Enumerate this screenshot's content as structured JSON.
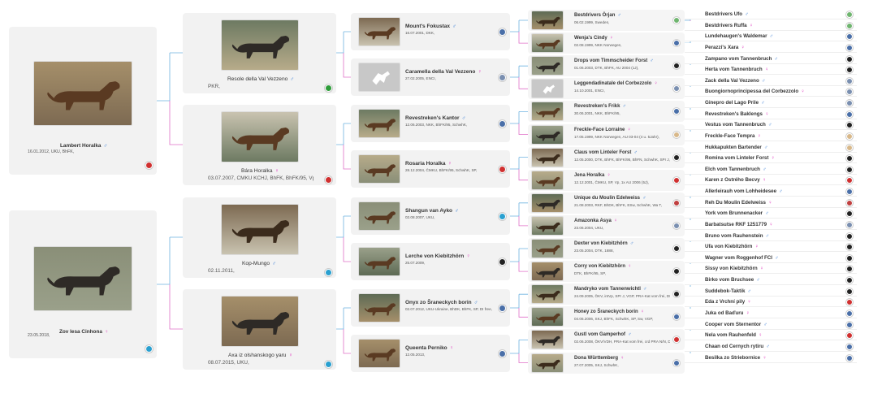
{
  "generations": {
    "g1": [
      {
        "name": "Lambert Horalka",
        "sex": "♂",
        "info": "16.01.2012, UKU, BhFK,",
        "flag_color": "#d03030"
      },
      {
        "name": "Zov lesa Cinhona",
        "sex": "♀",
        "info": "23.05.2018,",
        "flag_color": "#2aa0d0"
      }
    ],
    "g2": [
      {
        "name": "Resole della Val Vezzeno",
        "sex": "♂",
        "info": "PKR,",
        "flag_color": "#2e9d3a"
      },
      {
        "name": "Bára Horalka",
        "sex": "♀",
        "info": "03.07.2007, ČMKU KCHJ, BhFK, BhFK/95, Vp,",
        "flag_color": "#d03030"
      },
      {
        "name": "Kop-Mungo",
        "sex": "♂",
        "info": "02.11.2011,",
        "flag_color": "#2aa0d0"
      },
      {
        "name": "Axa iz olshanskogo yaru",
        "sex": "♀",
        "info": "08.07.2015, UKU,",
        "flag_color": "#2aa0d0"
      }
    ],
    "g3": [
      {
        "name": "Mount's Fokustax",
        "sex": "♂",
        "info": "16.07.2001, DKK,",
        "flag_color": "#4a6fa8"
      },
      {
        "name": "Caramella della Val Vezzeno",
        "sex": "♀",
        "info": "27.02.2005, ENCI,",
        "flag_color": "#7a8fb0"
      },
      {
        "name": "Revestreken's Kantor",
        "sex": "♂",
        "info": "12.06.2003, NKK, BhFK/95, SchwhK,",
        "flag_color": "#4a6fa8"
      },
      {
        "name": "Rosaria Horalka",
        "sex": "♀",
        "info": "28.12.2004, ČMKU, BhFK/95, SchwhK, SP,",
        "flag_color": "#d03030"
      },
      {
        "name": "Shangun van Ayko",
        "sex": "♂",
        "info": "02.08.2007, UKU,",
        "flag_color": "#2aa0d0"
      },
      {
        "name": "Lerche von Kiebitzhörn",
        "sex": "♀",
        "info": "25.07.2009,",
        "flag_color": "#222222"
      },
      {
        "name": "Onyx zo Šraneckych borin",
        "sex": "♂",
        "info": "02.07.2012, UKU-Ukraine, BhDK, BhFK, SP, DI free,",
        "flag_color": "#4a6fa8"
      },
      {
        "name": "Queenta Perniko",
        "sex": "♀",
        "info": "12.05.2013,",
        "flag_color": "#4a6fa8"
      }
    ],
    "g4": [
      {
        "name": "Bestdrivers Örjan",
        "sex": "♂",
        "info": "06.02.1999, Sweden,",
        "flag_color": "#6fb56f"
      },
      {
        "name": "Wenja's Cindy",
        "sex": "♀",
        "info": "02.08.1999, NKK Norwegen,",
        "flag_color": "#4a6fa8"
      },
      {
        "name": "Drops vom Timmscheider Forst",
        "sex": "♂",
        "info": "01.06.2003, DTK, BhFK, AU 2004 (1J),",
        "flag_color": "#222222"
      },
      {
        "name": "Leggendadinatale del Corbezzolo",
        "sex": "♀",
        "info": "14.10.2001, ENCI,",
        "flag_color": "#7a8fb0"
      },
      {
        "name": "Revestreken's Frikk",
        "sex": "♂",
        "info": "30.06.2001, NKK, BhFK/95,",
        "flag_color": "#4a6fa8"
      },
      {
        "name": "Freckle-Face Lorraine",
        "sex": "♀",
        "info": "17.05.1999, NKK Norwegen, AU 03-04 (4 u. 5Jahr),",
        "flag_color": "#d8b88a"
      },
      {
        "name": "Claus vom Linteler Forst",
        "sex": "♂",
        "info": "12.05.2000, DTK, BhFK, BhFK/95, BhFN, SchwhK, SPr J, VpzSp,",
        "flag_color": "#222222"
      },
      {
        "name": "Jena Horalka",
        "sex": "♀",
        "info": "12.12.2001, ČMKU, SP, Vp, 1x AU 2006 (5J),",
        "flag_color": "#d03030"
      },
      {
        "name": "Unique du Moulin Edelweiss",
        "sex": "♂",
        "info": "21.08.2003, RKF, BhDK, BhFK, ESw, SchwhK, Wa T,",
        "flag_color": "#c04040"
      },
      {
        "name": "Amazonka Asya",
        "sex": "♀",
        "info": "23.06.2004, UKU,",
        "flag_color": "#7a8fb0"
      },
      {
        "name": "Dexter von Kiebitzhörn",
        "sex": "♂",
        "info": "23.05.2004, DTK, 1888,",
        "flag_color": "#222222"
      },
      {
        "name": "Corry von Kiebitzhörn",
        "sex": "♀",
        "info": "DTK, BhFK/95, SP,",
        "flag_color": "#222222"
      },
      {
        "name": "Mandryko vom Tannenwichtl",
        "sex": "♂",
        "info": "24.09.2005, ÖKV, intVp, SPr J, VGP, PRA-Kat vom frei, DI frei, ordPRA-frei,",
        "flag_color": "#222222"
      },
      {
        "name": "Honey zo Šraneckych borin",
        "sex": "♀",
        "info": "04.06.2006, SKJ, BhFK, SchwhK, SP, Sw, VGP,",
        "flag_color": "#4a6fa8"
      },
      {
        "name": "Gustl vom Gamperhof",
        "sex": "♂",
        "info": "02.06.2008, ÖKV/VDH, PRA-Kat vom frei, crd PRA N/N, DI frei, DNA-Profil,",
        "flag_color": "#d03030"
      },
      {
        "name": "Dona Württemberg",
        "sex": "♀",
        "info": "27.07.2005, SKJ, SchwhK,",
        "flag_color": "#4a6fa8"
      }
    ],
    "g5": [
      {
        "name": "Bestdrivers Ufo",
        "sex": "♂",
        "flag_color": "#6fb56f"
      },
      {
        "name": "Bestdrivers Ruffa",
        "sex": "♀",
        "flag_color": "#6fb56f"
      },
      {
        "name": "Lundehaugen's Waldemar",
        "sex": "♂",
        "flag_color": "#4a6fa8"
      },
      {
        "name": "Perazzi's Xara",
        "sex": "♀",
        "flag_color": "#4a6fa8"
      },
      {
        "name": "Zampano vom Tannenbruch",
        "sex": "♂",
        "flag_color": "#222222"
      },
      {
        "name": "Herta vom Tannenbruch",
        "sex": "♀",
        "flag_color": "#222222"
      },
      {
        "name": "Zack della Val Vezzeno",
        "sex": "♂",
        "flag_color": "#7a8fb0"
      },
      {
        "name": "Buongiornoprincipessa del Corbezzolo",
        "sex": "♀",
        "flag_color": "#7a8fb0"
      },
      {
        "name": "Ginepro del Lago Prile",
        "sex": "♂",
        "flag_color": "#7a8fb0"
      },
      {
        "name": "Revestreken's Baklengs",
        "sex": "♀",
        "flag_color": "#4a6fa8"
      },
      {
        "name": "Vestus vom Tannenbruch",
        "sex": "♂",
        "flag_color": "#222222"
      },
      {
        "name": "Freckle-Face Tempra",
        "sex": "♀",
        "flag_color": "#d8b88a"
      },
      {
        "name": "Hukkapukten Bartender",
        "sex": "♂",
        "flag_color": "#d8b88a"
      },
      {
        "name": "Romina vom Linteler Forst",
        "sex": "♀",
        "flag_color": "#222222"
      },
      {
        "name": "Elch vom Tannenbruch",
        "sex": "♂",
        "flag_color": "#222222"
      },
      {
        "name": "Karen z Ostrého Becvy",
        "sex": "♀",
        "flag_color": "#d03030"
      },
      {
        "name": "Allerleirauh vom Lohheidesee",
        "sex": "♂",
        "flag_color": "#4a6fa8"
      },
      {
        "name": "Reh Du Moulin Edelweiss",
        "sex": "♀",
        "flag_color": "#c04040"
      },
      {
        "name": "York vom Brunnenacker",
        "sex": "♂",
        "flag_color": "#222222"
      },
      {
        "name": "Barbatsutse RKF 1251779",
        "sex": "♀",
        "flag_color": "#7a8fb0"
      },
      {
        "name": "Bruno vom Rauhenstein",
        "sex": "♂",
        "flag_color": "#222222"
      },
      {
        "name": "Ufa von Kiebitzhörn",
        "sex": "♀",
        "flag_color": "#222222"
      },
      {
        "name": "Wagner vom Roggenhof FCI",
        "sex": "♂",
        "flag_color": "#222222"
      },
      {
        "name": "Sissy von Kiebitzhörn",
        "sex": "♀",
        "flag_color": "#222222"
      },
      {
        "name": "Birko vom Bruchsee",
        "sex": "♂",
        "flag_color": "#222222"
      },
      {
        "name": "Suddebok-Taktik",
        "sex": "♂",
        "flag_color": "#222222"
      },
      {
        "name": "Eda z Vrchní pily",
        "sex": "♀",
        "flag_color": "#d03030"
      },
      {
        "name": "Juka od Baďuru",
        "sex": "♀",
        "flag_color": "#4a6fa8"
      },
      {
        "name": "Cooper vom Sternentor",
        "sex": "♂",
        "flag_color": "#4a6fa8"
      },
      {
        "name": "Nela vom Rauhenfeld",
        "sex": "♀",
        "flag_color": "#d03030"
      },
      {
        "name": "Chaan od Cernych rytiru",
        "sex": "♂",
        "flag_color": "#4a6fa8"
      },
      {
        "name": "Besilka zo Striebornice",
        "sex": "♀",
        "flag_color": "#4a6fa8"
      }
    ]
  }
}
